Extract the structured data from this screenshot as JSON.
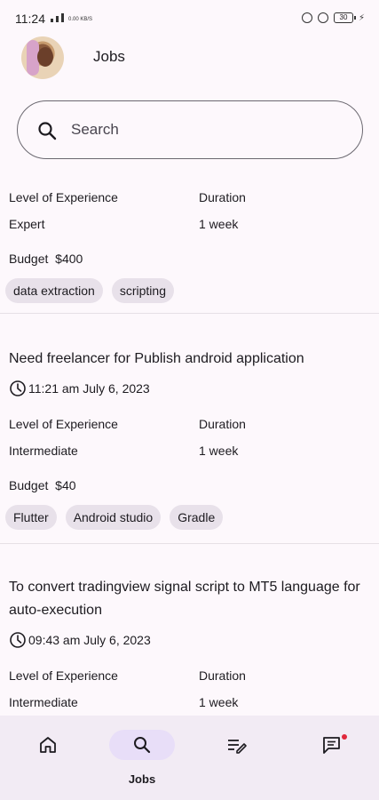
{
  "status_bar": {
    "time": "11:24",
    "speed": "0.00 KB/S",
    "battery": "30"
  },
  "header": {
    "title": "Jobs"
  },
  "search": {
    "placeholder": "Search"
  },
  "labels": {
    "level": "Level of Experience",
    "duration": "Duration",
    "budget_prefix": "Budget"
  },
  "jobs": [
    {
      "title": "",
      "time": "",
      "level": "Expert",
      "duration": "1 week",
      "budget": "$400",
      "tags": [
        "data extraction",
        "scripting"
      ]
    },
    {
      "title": "Need freelancer for Publish android application",
      "time": "11:21 am July 6, 2023",
      "level": "Intermediate",
      "duration": "1 week",
      "budget": "$40",
      "tags": [
        "Flutter",
        "Android studio",
        "Gradle"
      ]
    },
    {
      "title": "To convert tradingview signal script to MT5 language for auto-execution",
      "time": "09:43 am July 6, 2023",
      "level": "Intermediate",
      "duration": "1 week",
      "budget": "",
      "tags": []
    }
  ],
  "bottom_nav": {
    "items": [
      {
        "icon": "home-icon",
        "label": ""
      },
      {
        "icon": "search-icon",
        "label": "Jobs",
        "active": true
      },
      {
        "icon": "proposals-icon",
        "label": ""
      },
      {
        "icon": "messages-icon",
        "label": "",
        "badge": true
      }
    ]
  },
  "colors": {
    "background": "#fdf8fc",
    "active_pill": "#e8def8",
    "tag_bg": "#e8e1ea",
    "nav_bg": "#f2ebf4",
    "badge": "#e0283c"
  }
}
